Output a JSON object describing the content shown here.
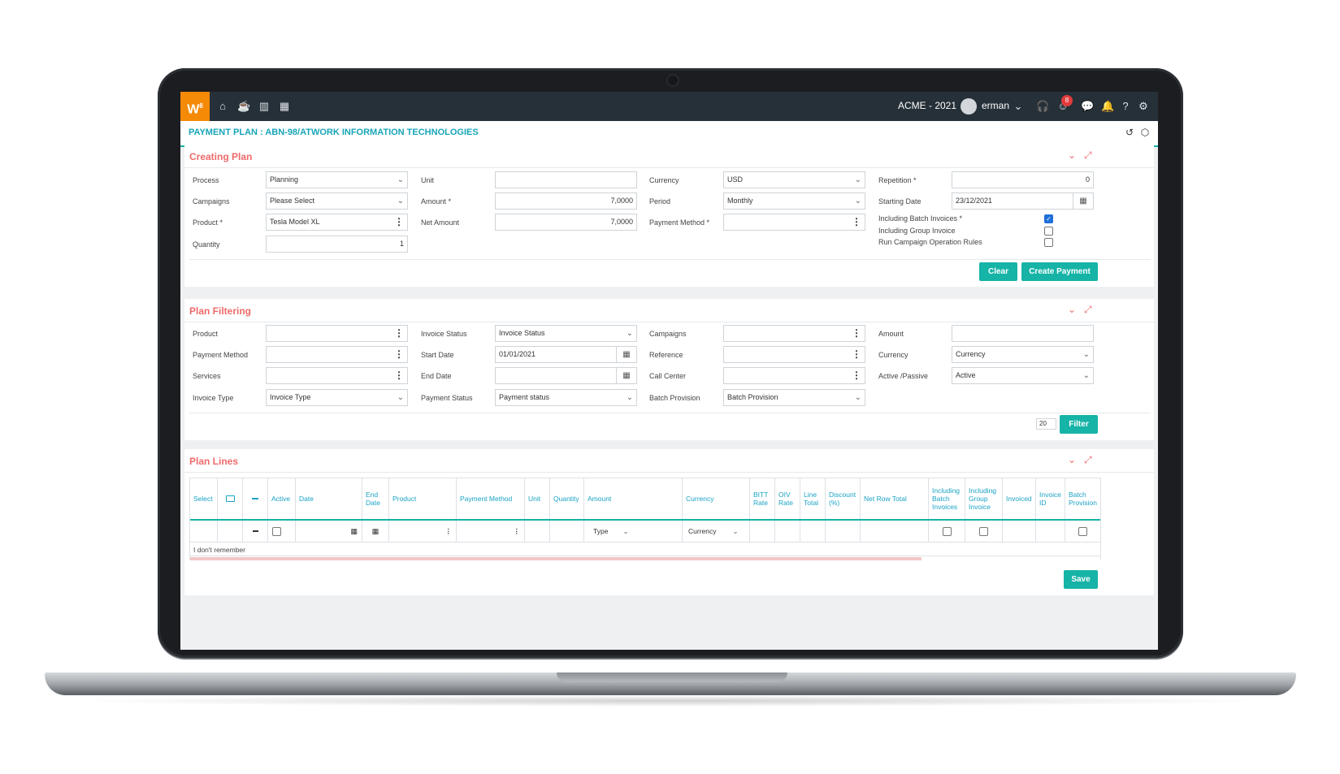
{
  "app": {
    "company": "ACME - 2021",
    "user": "erman",
    "notification_count": "8",
    "page_title": "PAYMENT PLAN : ABN-98/ATWORK INFORMATION TECHNOLOGIES",
    "accent": "#16b3a7",
    "brand": "#f58a07"
  },
  "creating_plan": {
    "title": "Creating Plan",
    "process_label": "Process",
    "process_value": "Planning",
    "campaigns_label": "Campaigns",
    "campaigns_value": "Please Select",
    "product_label": "Product *",
    "product_value": "Tesla Model XL",
    "quantity_label": "Quantity",
    "quantity_value": "1",
    "unit_label": "Unit",
    "unit_value": "",
    "amount_label": "Amount *",
    "amount_value": "7,0000",
    "net_amount_label": "Net Amount",
    "net_amount_value": "7,0000",
    "currency_label": "Currency",
    "currency_value": "USD",
    "period_label": "Period",
    "period_value": "Monthly",
    "payment_method_label": "Payment Method *",
    "payment_method_value": "",
    "repetition_label": "Repetition *",
    "repetition_value": "0",
    "starting_date_label": "Starting Date",
    "starting_date_value": "23/12/2021",
    "including_batch_label": "Including Batch Invoices *",
    "including_group_label": "Including Group Invoice",
    "run_campaign_label": "Run Campaign Operation Rules",
    "clear_label": "Clear",
    "create_payment_label": "Create Payment"
  },
  "plan_filtering": {
    "title": "Plan Filtering",
    "product_label": "Product",
    "payment_method_label": "Payment Method",
    "services_label": "Services",
    "invoice_type_label": "Invoice Type",
    "invoice_type_value": "Invoice Type",
    "invoice_status_label": "Invoice Status",
    "invoice_status_value": "Invoice Status",
    "start_date_label": "Start Date",
    "start_date_value": "01/01/2021",
    "end_date_label": "End Date",
    "payment_status_label": "Payment Status",
    "payment_status_value": "Payment status",
    "campaigns_label": "Campaigns",
    "reference_label": "Reference",
    "call_center_label": "Call Center",
    "batch_provision_label": "Batch Provision",
    "batch_provision_value": "Batch Provision",
    "amount_label": "Amount",
    "currency_label": "Currency",
    "currency_value": "Currency",
    "active_passive_label": "Active /Passive",
    "active_passive_value": "Active",
    "page_size": "20",
    "filter_label": "Filter"
  },
  "plan_lines": {
    "title": "Plan Lines",
    "columns": [
      "Select",
      "",
      "",
      "Active",
      "Date",
      "End Date",
      "Product",
      "Payment Method",
      "Unit",
      "Quantity",
      "Amount",
      "Currency",
      "BITT Rate",
      "OIV Rate",
      "Line Total",
      "Discount (%)",
      "Net Row Total",
      "Including Batch Invoices",
      "Including Group Invoice",
      "Invoiced",
      "Invoice ID",
      "Batch Provision"
    ],
    "row_type_value": "Type",
    "row_currency_value": "Currency",
    "note": "I don't remember",
    "save_label": "Save"
  }
}
